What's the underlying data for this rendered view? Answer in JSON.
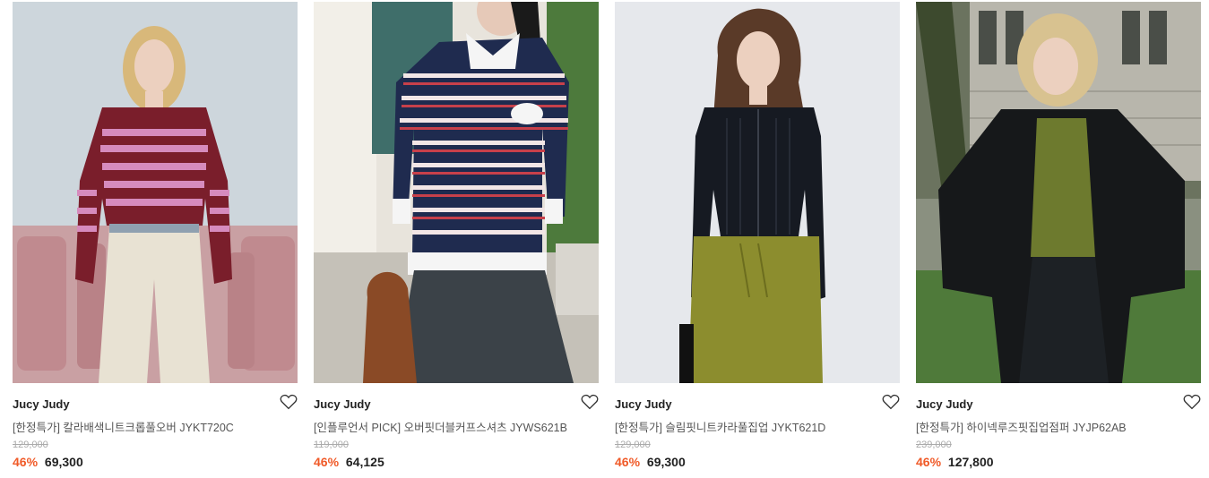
{
  "products": [
    {
      "brand": "Jucy Judy",
      "title": "[한정특가] 칼라배색니트크롭풀오버 JYKT720C",
      "original_price": "129,000",
      "discount": "46%",
      "sale_price": "69,300",
      "image_desc": "model-in-striped-burgundy-pink-sweater",
      "icon": "heart-icon"
    },
    {
      "brand": "Jucy Judy",
      "title": "[인플루언서 PICK] 오버핏더블커프스셔츠 JYWS621B",
      "original_price": "119,000",
      "discount": "46%",
      "sale_price": "64,125",
      "image_desc": "model-in-navy-striped-shirt-with-bag",
      "icon": "heart-icon"
    },
    {
      "brand": "Jucy Judy",
      "title": "[한정특가] 슬림핏니트카라풀집업 JYKT621D",
      "original_price": "129,000",
      "discount": "46%",
      "sale_price": "69,300",
      "image_desc": "model-in-black-knit-zip-cardigan-olive-pants",
      "icon": "heart-icon"
    },
    {
      "brand": "Jucy Judy",
      "title": "[한정특가] 하이넥루즈핏집업점퍼 JYJP62AB",
      "original_price": "239,000",
      "discount": "46%",
      "sale_price": "127,800",
      "image_desc": "model-in-black-jacket-outdoors",
      "icon": "heart-icon"
    }
  ],
  "colors": {
    "discount": "#f05a28",
    "text": "#222222",
    "muted": "#aaaaaa"
  }
}
